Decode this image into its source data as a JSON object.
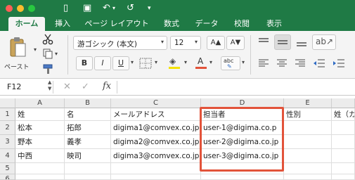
{
  "titlebar": {
    "lights": [
      "#ff5f57",
      "#febc2e",
      "#28c840"
    ],
    "qat_icons": [
      "sidebar-icon",
      "save-icon",
      "undo-icon",
      "redo-icon",
      "customize-icon"
    ],
    "qat_glyphs": [
      "▯",
      "▣",
      "↶",
      "↺",
      "≡"
    ]
  },
  "tabs": [
    "ホーム",
    "挿入",
    "ページ レイアウト",
    "数式",
    "データ",
    "校閲",
    "表示"
  ],
  "ribbon": {
    "paste_label": "ペースト",
    "font_name": "游ゴシック (本文)",
    "font_size": "12",
    "grow_label": "A▲",
    "shrink_label": "A▼",
    "bold": "B",
    "italic": "I",
    "underline": "U",
    "abc_label": "abc",
    "fill_glyph": "◈",
    "font_color_glyph": "A",
    "accent_red": "#e2533a",
    "accent_yellow": "#f5e200"
  },
  "formula_bar": {
    "name_box": "F12",
    "fx": "fx",
    "content": ""
  },
  "columns": [
    "A",
    "B",
    "C",
    "D",
    "E"
  ],
  "rows": [
    {
      "num": "1",
      "cells": [
        "姓",
        "名",
        "メールアドレス",
        "担当者",
        "性別",
        "姓（カ"
      ]
    },
    {
      "num": "2",
      "cells": [
        "松本",
        "拓郎",
        "digima1@comvex.co.jp",
        "user-1@digima.co.p",
        "",
        ""
      ]
    },
    {
      "num": "3",
      "cells": [
        "野本",
        "義孝",
        "digima2@comvex.co.jp",
        "user-2@digima.co.jp",
        "",
        ""
      ]
    },
    {
      "num": "4",
      "cells": [
        "中西",
        "映司",
        "digima3@comvex.co.jp",
        "user-3@digima.co.jp",
        "",
        ""
      ]
    },
    {
      "num": "5",
      "cells": [
        "",
        "",
        "",
        "",
        "",
        ""
      ]
    },
    {
      "num": "6",
      "cells": [
        "",
        "",
        "",
        "",
        "",
        ""
      ]
    }
  ]
}
